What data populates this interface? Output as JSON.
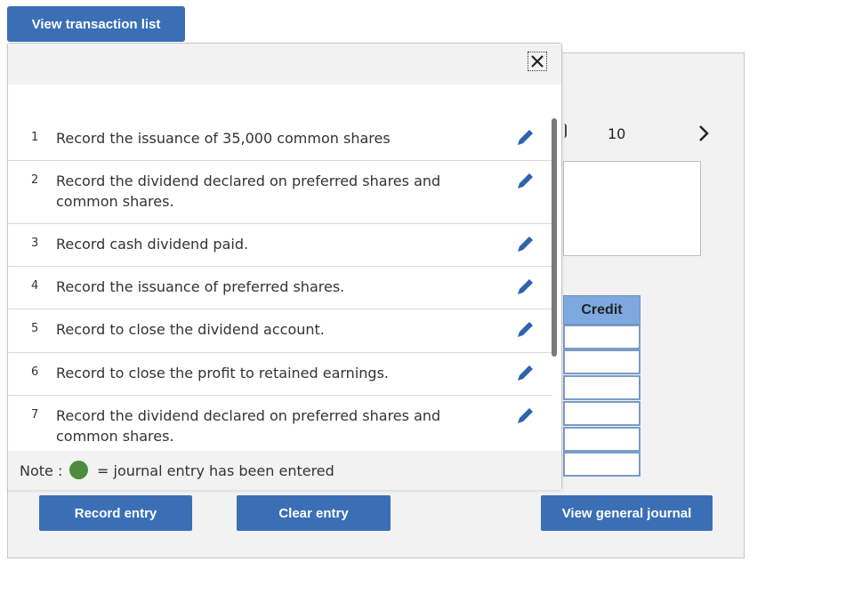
{
  "top_button": {
    "label": "View transaction list"
  },
  "right": {
    "page_number": "10",
    "credit_header": "Credit"
  },
  "buttons": {
    "record": "Record entry",
    "clear": "Clear entry",
    "view_journal": "View general journal"
  },
  "transactions": [
    {
      "num": "1",
      "text": "Record the issuance of 35,000 common shares"
    },
    {
      "num": "2",
      "text": "Record the dividend declared on preferred shares and common shares."
    },
    {
      "num": "3",
      "text": "Record cash dividend paid."
    },
    {
      "num": "4",
      "text": "Record the issuance of preferred shares."
    },
    {
      "num": "5",
      "text": "Record to close the dividend account."
    },
    {
      "num": "6",
      "text": "Record to close the profit to retained earnings."
    },
    {
      "num": "7",
      "text": "Record the dividend declared on preferred shares and common shares."
    }
  ],
  "note": {
    "label": "Note :",
    "text": "= journal entry has been entered",
    "dot_color": "#4e8b3c"
  },
  "colors": {
    "accent": "#3a6fb6",
    "header_blue": "#7da9e0",
    "pencil": "#2f63ad"
  }
}
